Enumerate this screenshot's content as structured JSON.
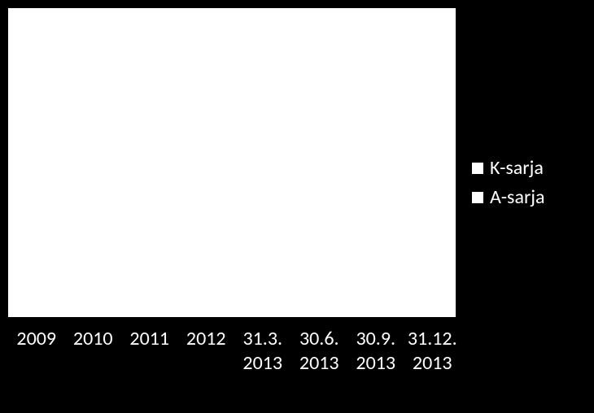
{
  "chart_data": {
    "type": "bar",
    "title": "",
    "xlabel": "",
    "ylabel": "",
    "ylim": null,
    "categories": [
      "2009",
      "2010",
      "2011",
      "2012",
      "31.3. 2013",
      "30.6. 2013",
      "30.9. 2013",
      "31.12. 2013"
    ],
    "series": [
      {
        "name": "K-sarja",
        "values": [
          null,
          null,
          null,
          null,
          null,
          null,
          null,
          null
        ]
      },
      {
        "name": "A-sarja",
        "values": [
          null,
          null,
          null,
          null,
          null,
          null,
          null,
          null
        ]
      }
    ],
    "note": "Plot area is blank in the source image; only axis labels and legend are visible. Values unknown."
  },
  "legend": {
    "items": [
      {
        "label": "K-sarja"
      },
      {
        "label": "A-sarja"
      }
    ]
  },
  "x_ticks": [
    "2009",
    "2010",
    "2011",
    "2012",
    "31.3. 2013",
    "30.6. 2013",
    "30.9. 2013",
    "31.12. 2013"
  ]
}
